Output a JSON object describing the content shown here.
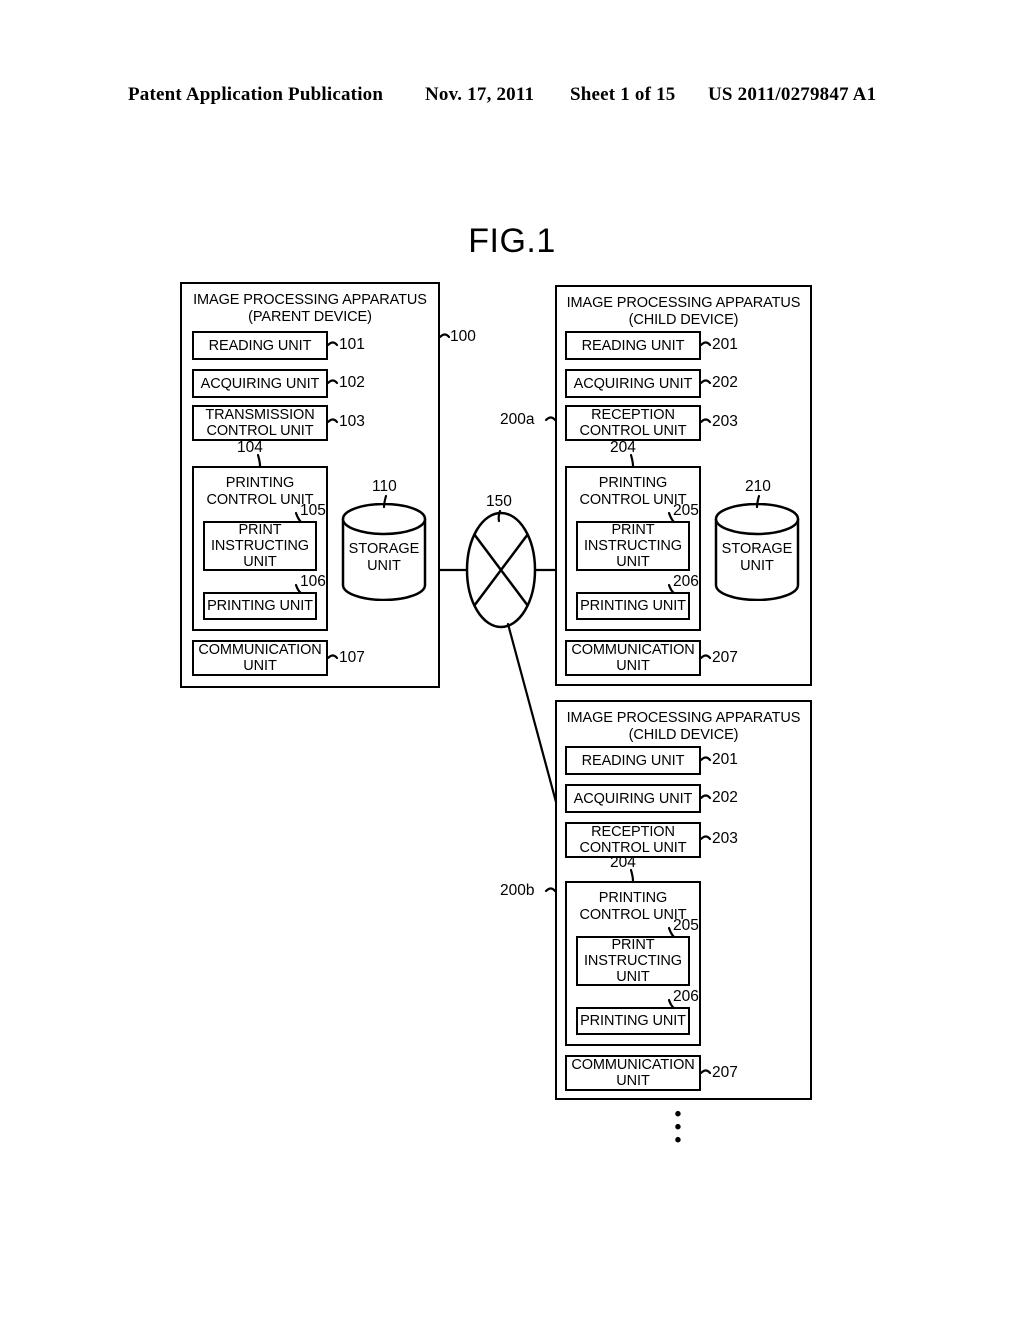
{
  "header": {
    "publication": "Patent Application Publication",
    "date": "Nov. 17, 2011",
    "sheet": "Sheet 1 of 15",
    "number": "US 2011/0279847 A1"
  },
  "figure": {
    "title": "FIG.1",
    "continuation_dots": "•"
  },
  "parent_device": {
    "title": "IMAGE PROCESSING APPARATUS\n(PARENT DEVICE)",
    "ref": "100",
    "units": [
      {
        "label": "READING UNIT",
        "ref": "101"
      },
      {
        "label": "ACQUIRING UNIT",
        "ref": "102"
      },
      {
        "label": "TRANSMISSION\nCONTROL UNIT",
        "ref": "103"
      }
    ],
    "printing_control": {
      "label": "PRINTING\nCONTROL UNIT",
      "ref": "104",
      "children": [
        {
          "label": "PRINT\nINSTRUCTING\nUNIT",
          "ref": "105"
        },
        {
          "label": "PRINTING UNIT",
          "ref": "106"
        }
      ]
    },
    "communication": {
      "label": "COMMUNICATION\nUNIT",
      "ref": "107"
    },
    "storage": {
      "label": "STORAGE\nUNIT",
      "ref": "110"
    }
  },
  "child_device_a": {
    "title": "IMAGE PROCESSING APPARATUS\n(CHILD DEVICE)",
    "ref": "200a",
    "units": [
      {
        "label": "READING UNIT",
        "ref": "201"
      },
      {
        "label": "ACQUIRING UNIT",
        "ref": "202"
      },
      {
        "label": "RECEPTION\nCONTROL UNIT",
        "ref": "203"
      }
    ],
    "printing_control": {
      "label": "PRINTING\nCONTROL UNIT",
      "ref": "204",
      "children": [
        {
          "label": "PRINT\nINSTRUCTING\nUNIT",
          "ref": "205"
        },
        {
          "label": "PRINTING UNIT",
          "ref": "206"
        }
      ]
    },
    "communication": {
      "label": "COMMUNICATION\nUNIT",
      "ref": "207"
    },
    "storage": {
      "label": "STORAGE\nUNIT",
      "ref": "210"
    }
  },
  "child_device_b": {
    "title": "IMAGE PROCESSING APPARATUS\n(CHILD DEVICE)",
    "ref": "200b",
    "units": [
      {
        "label": "READING UNIT",
        "ref": "201"
      },
      {
        "label": "ACQUIRING UNIT",
        "ref": "202"
      },
      {
        "label": "RECEPTION\nCONTROL UNIT",
        "ref": "203"
      }
    ],
    "printing_control": {
      "label": "PRINTING\nCONTROL UNIT",
      "ref": "204",
      "children": [
        {
          "label": "PRINT\nINSTRUCTING\nUNIT",
          "ref": "205"
        },
        {
          "label": "PRINTING UNIT",
          "ref": "206"
        }
      ]
    },
    "communication": {
      "label": "COMMUNICATION\nUNIT",
      "ref": "207"
    }
  },
  "network": {
    "ref": "150"
  },
  "colors": {
    "ink": "#000000",
    "paper": "#ffffff"
  }
}
